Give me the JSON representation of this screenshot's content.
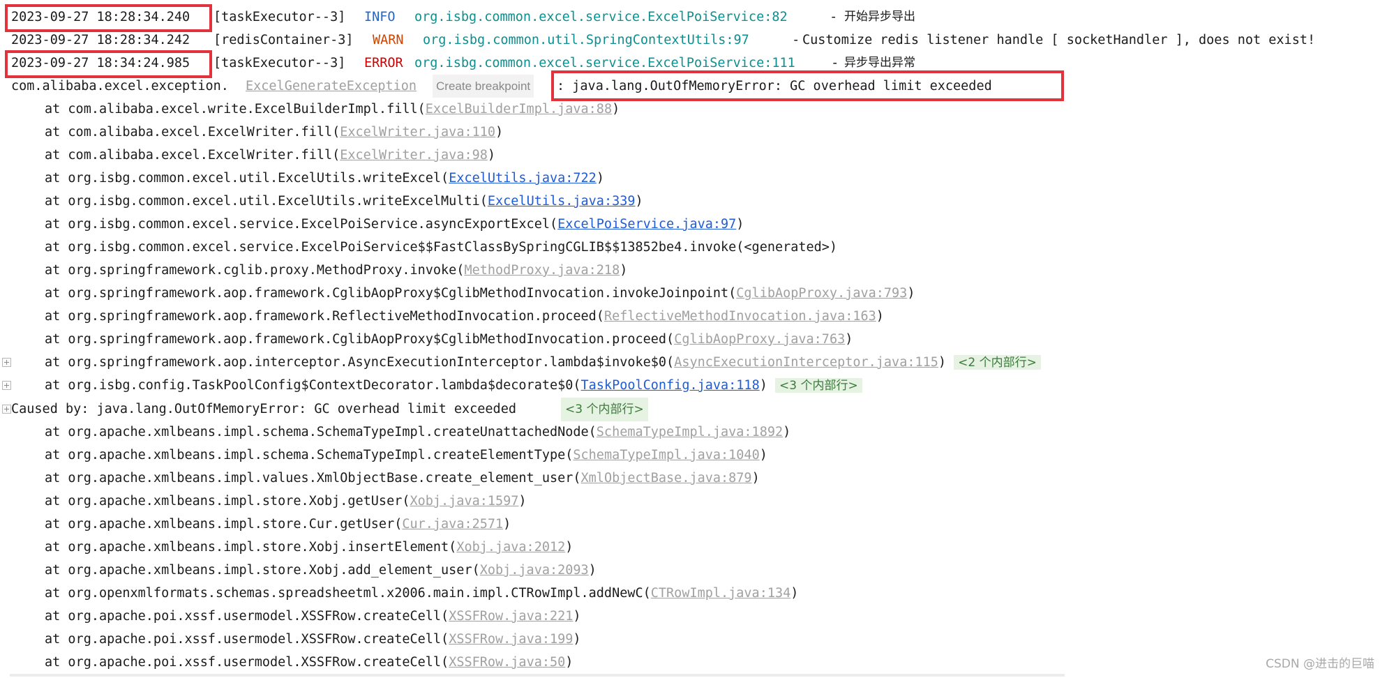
{
  "log": {
    "entries": [
      {
        "time": "2023-09-27 18:28:34.240",
        "thread": "[taskExecutor--3]",
        "level": "INFO",
        "logger": "org.isbg.common.excel.service.ExcelPoiService:82",
        "sep": " - ",
        "msg": "开始异步导出"
      },
      {
        "time": "2023-09-27 18:28:34.242",
        "thread": "[redisContainer-3]",
        "level": "WARN",
        "logger": "org.isbg.common.util.SpringContextUtils:97",
        "sep": " - ",
        "msg": "Customize redis listener handle [ socketHandler ], does not exist!"
      },
      {
        "time": "2023-09-27 18:34:24.985",
        "thread": "[taskExecutor--3]",
        "level": "ERROR",
        "logger": "org.isbg.common.excel.service.ExcelPoiService:111",
        "sep": " - ",
        "msg": "异步导出异常"
      }
    ],
    "exception": {
      "prefix": "com.alibaba.excel.exception.",
      "class_link": "ExcelGenerateException",
      "breakpoint_label": "Create breakpoint",
      "message": ": java.lang.OutOfMemoryError: GC overhead limit exceeded"
    },
    "trace_a": [
      {
        "method": "at com.alibaba.excel.write.ExcelBuilderImpl.fill(",
        "loc": "ExcelBuilderImpl.java:88",
        "close": ")"
      },
      {
        "method": "at com.alibaba.excel.ExcelWriter.fill(",
        "loc": "ExcelWriter.java:110",
        "close": ")"
      },
      {
        "method": "at com.alibaba.excel.ExcelWriter.fill(",
        "loc": "ExcelWriter.java:98",
        "close": ")"
      },
      {
        "method": "at org.isbg.common.excel.util.ExcelUtils.writeExcel(",
        "loc": "ExcelUtils.java:722",
        "close": ")"
      },
      {
        "method": "at org.isbg.common.excel.util.ExcelUtils.writeExcelMulti(",
        "loc": "ExcelUtils.java:339",
        "close": ")"
      },
      {
        "method": "at org.isbg.common.excel.service.ExcelPoiService.asyncExportExcel(",
        "loc": "ExcelPoiService.java:97",
        "close": ")"
      },
      {
        "method": "at org.isbg.common.excel.service.ExcelPoiService$$FastClassBySpringCGLIB$$13852be4.invoke(<generated>)",
        "loc": "",
        "close": ""
      },
      {
        "method": "at org.springframework.cglib.proxy.MethodProxy.invoke(",
        "loc": "MethodProxy.java:218",
        "close": ")"
      },
      {
        "method": "at org.springframework.aop.framework.CglibAopProxy$CglibMethodInvocation.invokeJoinpoint(",
        "loc": "CglibAopProxy.java:793",
        "close": ")"
      },
      {
        "method": "at org.springframework.aop.framework.ReflectiveMethodInvocation.proceed(",
        "loc": "ReflectiveMethodInvocation.java:163",
        "close": ")"
      },
      {
        "method": "at org.springframework.aop.framework.CglibAopProxy$CglibMethodInvocation.proceed(",
        "loc": "CglibAopProxy.java:763",
        "close": ")"
      },
      {
        "method": "at org.springframework.aop.interceptor.AsyncExecutionInterceptor.lambda$invoke$0(",
        "loc": "AsyncExecutionInterceptor.java:115",
        "close": ")",
        "folded": "<2 个内部行>"
      },
      {
        "method": "at org.isbg.config.TaskPoolConfig$ContextDecorator.lambda$decorate$0(",
        "loc": "TaskPoolConfig.java:118",
        "close": ")",
        "folded": "<3 个内部行>"
      }
    ],
    "caused_by": {
      "text": "Caused by: java.lang.OutOfMemoryError: GC overhead limit exceeded",
      "folded": "<3 个内部行>"
    },
    "trace_b": [
      {
        "method": "at org.apache.xmlbeans.impl.schema.SchemaTypeImpl.createUnattachedNode(",
        "loc": "SchemaTypeImpl.java:1892",
        "close": ")"
      },
      {
        "method": "at org.apache.xmlbeans.impl.schema.SchemaTypeImpl.createElementType(",
        "loc": "SchemaTypeImpl.java:1040",
        "close": ")"
      },
      {
        "method": "at org.apache.xmlbeans.impl.values.XmlObjectBase.create_element_user(",
        "loc": "XmlObjectBase.java:879",
        "close": ")"
      },
      {
        "method": "at org.apache.xmlbeans.impl.store.Xobj.getUser(",
        "loc": "Xobj.java:1597",
        "close": ")"
      },
      {
        "method": "at org.apache.xmlbeans.impl.store.Cur.getUser(",
        "loc": "Cur.java:2571",
        "close": ")"
      },
      {
        "method": "at org.apache.xmlbeans.impl.store.Xobj.insertElement(",
        "loc": "Xobj.java:2012",
        "close": ")"
      },
      {
        "method": "at org.apache.xmlbeans.impl.store.Xobj.add_element_user(",
        "loc": "Xobj.java:2093",
        "close": ")"
      },
      {
        "method": "at org.openxmlformats.schemas.spreadsheetml.x2006.main.impl.CTRowImpl.addNewC(",
        "loc": "CTRowImpl.java:134",
        "close": ")"
      },
      {
        "method": "at org.apache.poi.xssf.usermodel.XSSFRow.createCell(",
        "loc": "XSSFRow.java:221",
        "close": ")"
      },
      {
        "method": "at org.apache.poi.xssf.usermodel.XSSFRow.createCell(",
        "loc": "XSSFRow.java:199",
        "close": ")"
      },
      {
        "method": "at org.apache.poi.xssf.usermodel.XSSFRow.createCell(",
        "loc": "XSSFRow.java:50",
        "close": ")"
      }
    ]
  },
  "watermark": "CSDN @进击的巨喵",
  "colors": {
    "info": "#2266cc",
    "warn": "#cc4400",
    "error": "#cc0000",
    "logger": "#0e8f8f",
    "link": "#1f5bd6",
    "highlight_box": "#e2323b",
    "folded_bg": "#e6f3e2"
  }
}
